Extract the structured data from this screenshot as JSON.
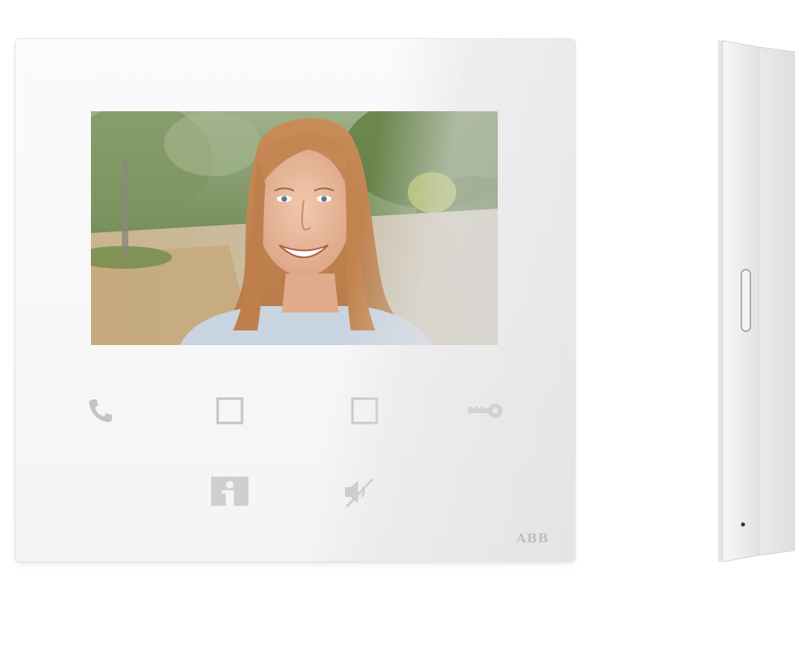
{
  "device": {
    "brand": "ABB",
    "buttons": [
      {
        "id": "call",
        "icon": "phone-icon"
      },
      {
        "id": "function-1",
        "icon": "square-icon"
      },
      {
        "id": "function-2",
        "icon": "square-icon"
      },
      {
        "id": "door-unlock",
        "icon": "key-icon"
      },
      {
        "id": "surveillance",
        "icon": "info-person-icon"
      },
      {
        "id": "mute",
        "icon": "mute-speaker-icon"
      }
    ],
    "colors": {
      "panel": "#f6f6f6",
      "icons": "#bdbdbd",
      "brand": "#9a9a9a"
    }
  }
}
